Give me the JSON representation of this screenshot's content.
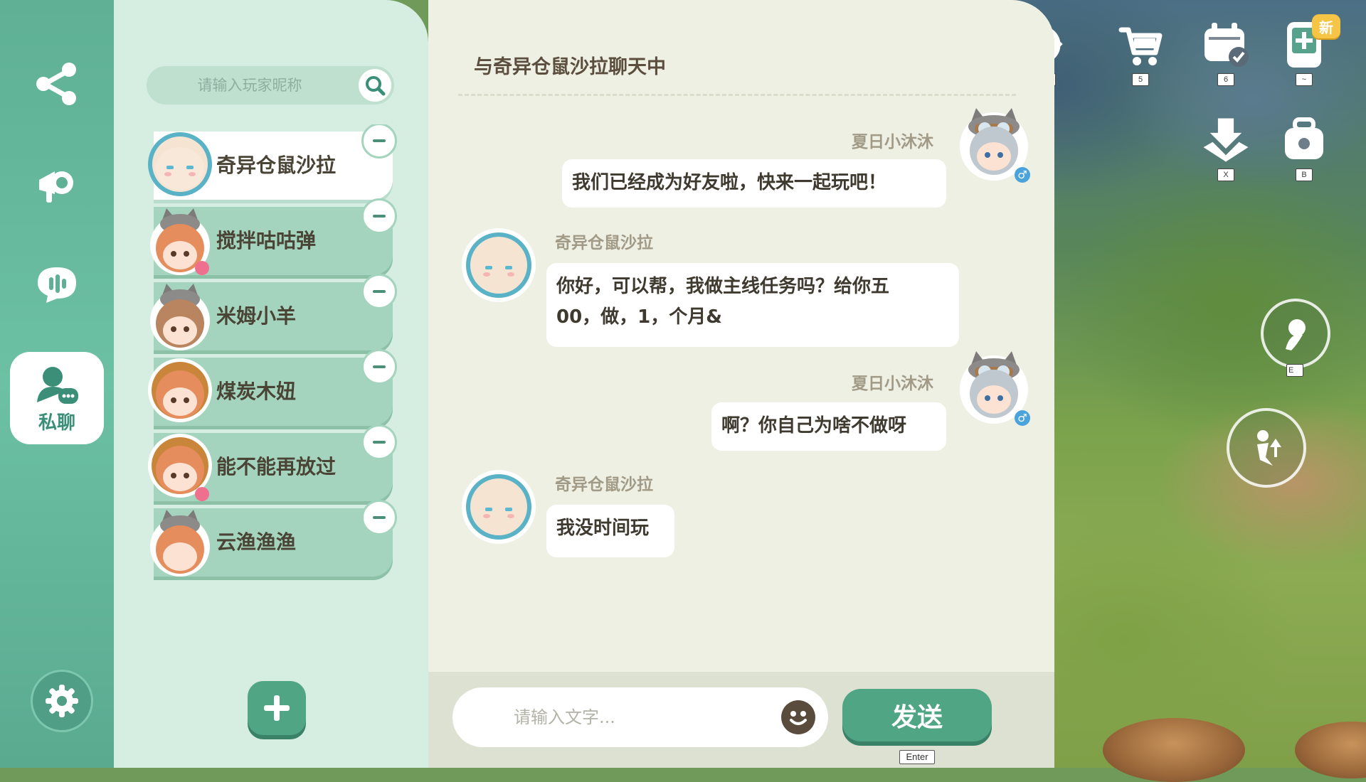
{
  "hud": {
    "items": [
      {
        "name": "cycle",
        "key": "4"
      },
      {
        "name": "shop-cart",
        "key": "5"
      },
      {
        "name": "calendar",
        "key": "6"
      },
      {
        "name": "phone",
        "key": "~",
        "badge": "新"
      },
      {
        "name": "download",
        "key": "X"
      },
      {
        "name": "backpack",
        "key": "B"
      }
    ],
    "action_e_key": "E"
  },
  "rail": {
    "active_label": "私聊",
    "accent": "#5fb095"
  },
  "friends": {
    "search_placeholder": "请输入玩家昵称",
    "list": [
      {
        "name": "奇异仓鼠沙拉",
        "active": true
      },
      {
        "name": "搅拌咕咕弹",
        "gender": "♀"
      },
      {
        "name": "米姆小羊"
      },
      {
        "name": "煤炭木妞"
      },
      {
        "name": "能不能再放过",
        "gender": "♀"
      },
      {
        "name": "云渔渔渔"
      }
    ]
  },
  "chat": {
    "title": "与奇异仓鼠沙拉聊天中",
    "messages": [
      {
        "sender": "夏日小沐沐",
        "side": "right",
        "lines": [
          "我们已经成为好友啦，快来一起玩吧！"
        ],
        "gender": "♂"
      },
      {
        "sender": "奇异仓鼠沙拉",
        "side": "left",
        "lines": [
          "你好，可以帮，我做主线任务吗？给你五",
          "00，做，1，个月&"
        ]
      },
      {
        "sender": "夏日小沐沐",
        "side": "right",
        "lines": [
          "啊？你自己为啥不做呀"
        ],
        "gender": "♂"
      },
      {
        "sender": "奇异仓鼠沙拉",
        "side": "left",
        "lines": [
          "我没时间玩"
        ]
      }
    ],
    "input_placeholder": "请输入文字...",
    "send_label": "发送",
    "send_key": "Enter"
  }
}
